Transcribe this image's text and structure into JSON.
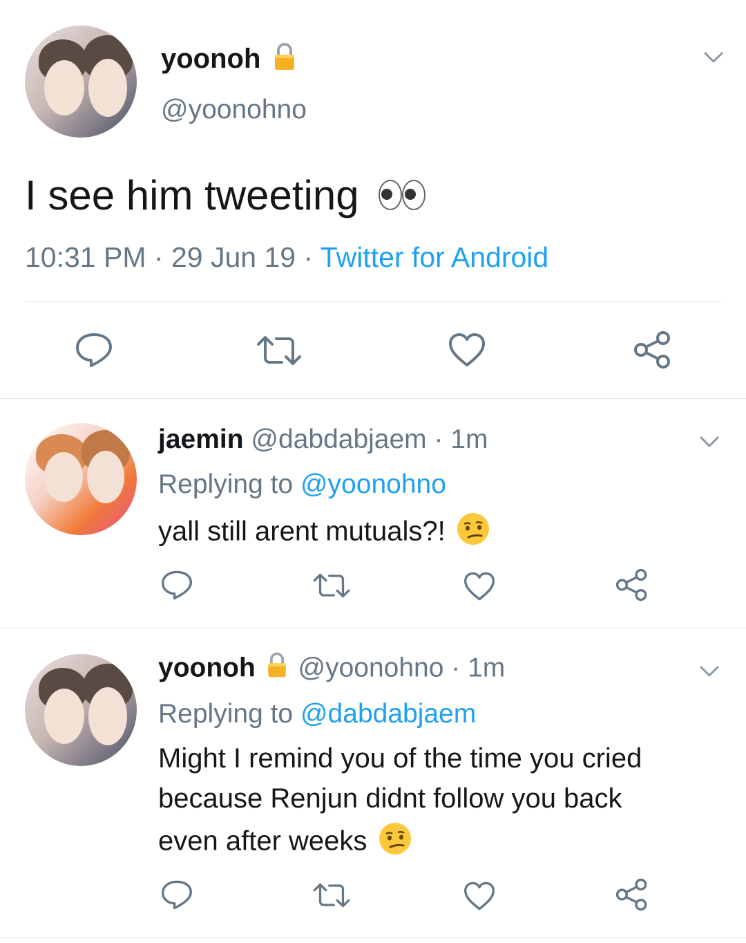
{
  "main_tweet": {
    "display_name": "yoonoh",
    "handle": "@yoonohno",
    "text": "I see him tweeting",
    "emoji_icon": "eyes-emoji-icon",
    "time": "10:31 PM",
    "dot1": "·",
    "date": "29 Jun 19",
    "dot2": "·",
    "source": "Twitter for Android"
  },
  "replies": [
    {
      "display_name": "jaemin",
      "handle": "@dabdabjaem",
      "dot": "·",
      "age": "1m",
      "replying_label": "Replying to",
      "replying_to": "@yoonohno",
      "text": "yall still arent mutuals?!",
      "emoji_icon": "smirk-emoji-icon"
    },
    {
      "display_name": "yoonoh",
      "handle": "@yoonohno",
      "dot": "·",
      "age": "1m",
      "replying_label": "Replying to",
      "replying_to": "@dabdabjaem",
      "text_line1": "Might I remind you of the time you cried",
      "text_line2": "because Renjun didnt follow you back",
      "text_line3": "even after weeks",
      "emoji_icon": "smirk-emoji-icon"
    }
  ],
  "colors": {
    "link": "#1da1f2",
    "secondary": "#657786",
    "icon": "#657786",
    "divider": "#e1e8ed"
  },
  "icons": [
    "chevron-down-icon",
    "lock-icon",
    "reply-icon",
    "retweet-icon",
    "like-icon",
    "share-icon"
  ]
}
